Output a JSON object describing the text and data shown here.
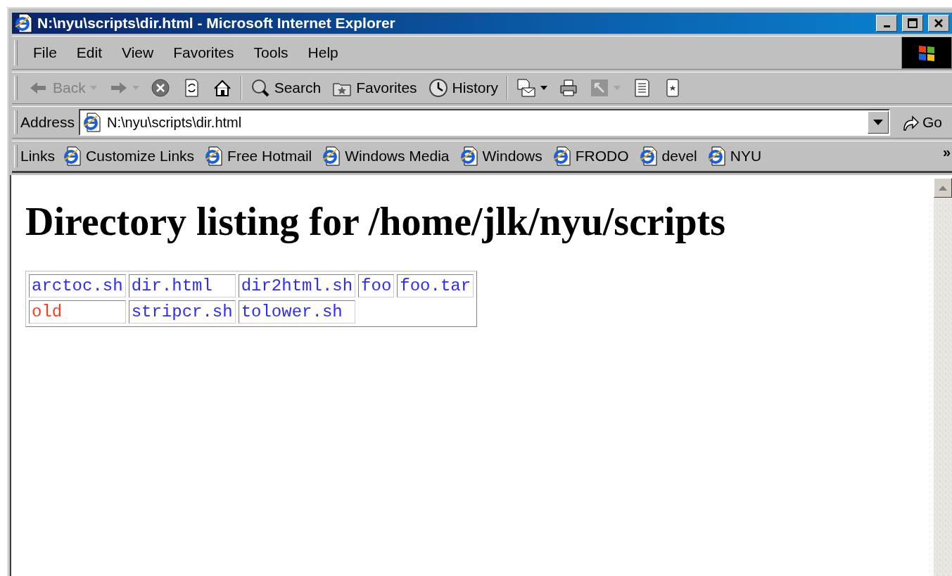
{
  "window": {
    "title": "N:\\nyu\\scripts\\dir.html - Microsoft Internet Explorer"
  },
  "menu": [
    {
      "label": "File"
    },
    {
      "label": "Edit"
    },
    {
      "label": "View"
    },
    {
      "label": "Favorites"
    },
    {
      "label": "Tools"
    },
    {
      "label": "Help"
    }
  ],
  "toolbar": {
    "groups": [
      {
        "items": [
          {
            "kind": "back",
            "label": "Back",
            "disabled": true,
            "dropdown": true
          },
          {
            "kind": "forward",
            "disabled": true,
            "dropdown": true
          },
          {
            "kind": "stop",
            "disabled": false,
            "dropdown": false
          },
          {
            "kind": "refresh",
            "disabled": false,
            "dropdown": false
          },
          {
            "kind": "home",
            "disabled": false,
            "dropdown": false
          }
        ]
      },
      {
        "items": [
          {
            "kind": "search",
            "label": "Search",
            "disabled": false,
            "dropdown": false
          },
          {
            "kind": "favorites",
            "label": "Favorites",
            "disabled": false,
            "dropdown": false
          },
          {
            "kind": "history",
            "label": "History",
            "disabled": false,
            "dropdown": false
          }
        ]
      },
      {
        "items": [
          {
            "kind": "mail",
            "disabled": false,
            "dropdown": true
          },
          {
            "kind": "print",
            "disabled": false,
            "dropdown": false
          },
          {
            "kind": "edit",
            "disabled": true,
            "dropdown": true
          },
          {
            "kind": "discuss",
            "disabled": false,
            "dropdown": false
          },
          {
            "kind": "messenger",
            "disabled": false,
            "dropdown": false
          }
        ]
      }
    ]
  },
  "address": {
    "label": "Address",
    "value": "N:\\nyu\\scripts\\dir.html",
    "go": "Go"
  },
  "links": {
    "label": "Links",
    "items": [
      {
        "label": "Customize Links"
      },
      {
        "label": "Free Hotmail"
      },
      {
        "label": "Windows Media"
      },
      {
        "label": "Windows"
      },
      {
        "label": "FRODO"
      },
      {
        "label": "devel"
      },
      {
        "label": "NYU"
      }
    ],
    "more": "»"
  },
  "page": {
    "heading": "Directory listing for /home/jlk/nyu/scripts",
    "table": {
      "rows": [
        {
          "cells": [
            {
              "text": "arctoc.sh",
              "color": "#2b2bff"
            },
            {
              "text": "dir.html",
              "color": "#2b2bff"
            },
            {
              "text": "dir2html.sh",
              "color": "#2b2bff"
            },
            {
              "text": "foo",
              "color": "#2b2bff"
            },
            {
              "text": "foo.tar",
              "color": "#2b2bff"
            }
          ]
        },
        {
          "cells": [
            {
              "text": "old",
              "color": "#ff3a1a"
            },
            {
              "text": "stripcr.sh",
              "color": "#2b2bff"
            },
            {
              "text": "tolower.sh",
              "color": "#2b2bff"
            }
          ]
        }
      ]
    }
  }
}
